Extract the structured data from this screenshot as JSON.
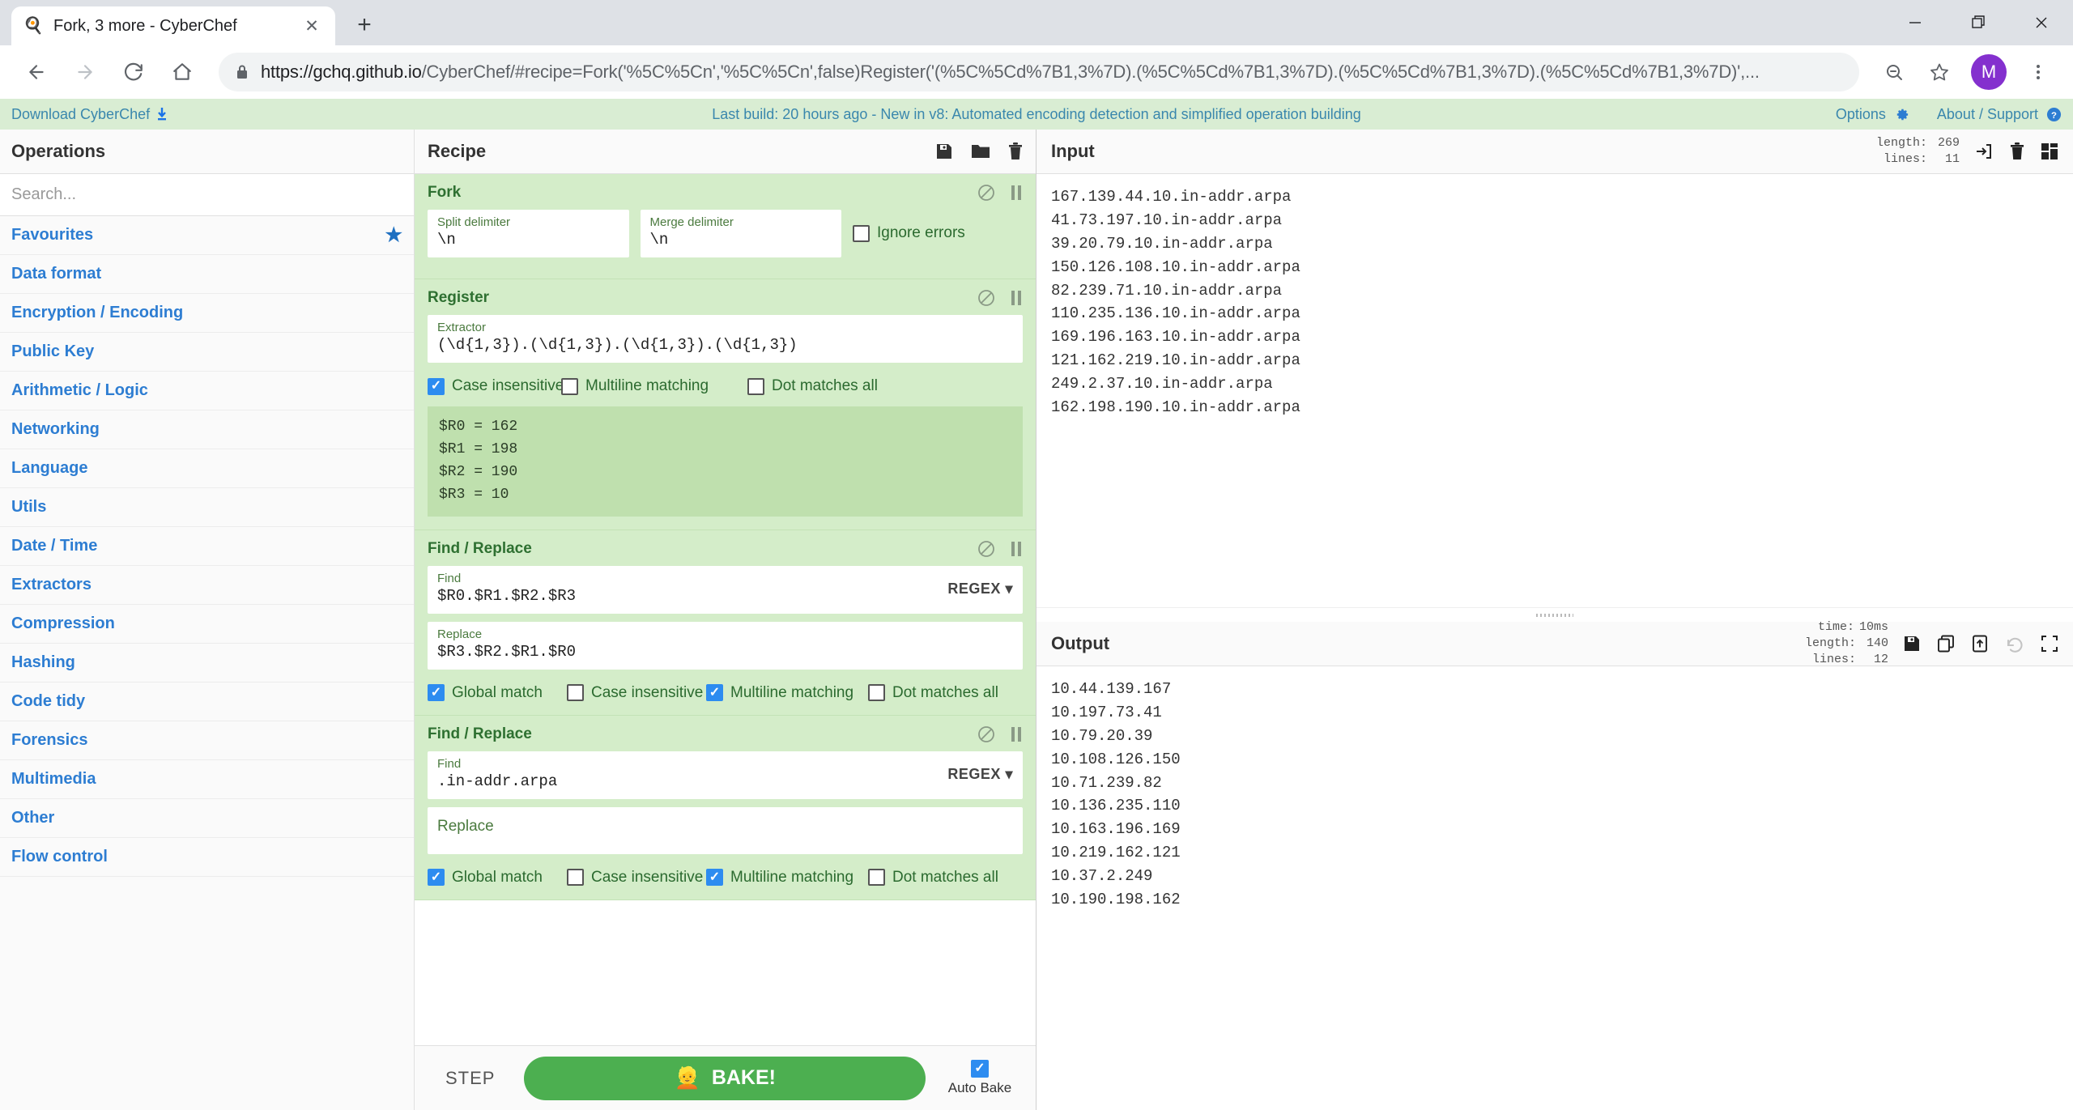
{
  "browser": {
    "tab": {
      "title": "Fork, 3 more - CyberChef",
      "favicon": "chef-hat-icon",
      "close_label": "✕"
    },
    "new_tab_label": "+",
    "window_controls": {
      "minimize": "minimize-icon",
      "maximize": "maximize-icon",
      "close": "close-icon"
    },
    "url_scheme": "https://",
    "url_host": "gchq.github.io",
    "url_path": "/CyberChef/#recipe=Fork('%5C%5Cn','%5C%5Cn',false)Register('(%5C%5Cd%7B1,3%7D).(%5C%5Cd%7B1,3%7D).(%5C%5Cd%7B1,3%7D).(%5C%5Cd%7B1,3%7D)',...",
    "avatar_initial": "M"
  },
  "banner": {
    "download_label": "Download CyberChef",
    "center_text": "Last build: 20 hours ago - New in v8: Automated encoding detection and simplified operation building",
    "options_label": "Options",
    "about_label": "About / Support"
  },
  "operations": {
    "title": "Operations",
    "search_placeholder": "Search...",
    "items": [
      {
        "label": "Favourites",
        "starred": true
      },
      {
        "label": "Data format",
        "starred": false
      },
      {
        "label": "Encryption / Encoding",
        "starred": false
      },
      {
        "label": "Public Key",
        "starred": false
      },
      {
        "label": "Arithmetic / Logic",
        "starred": false
      },
      {
        "label": "Networking",
        "starred": false
      },
      {
        "label": "Language",
        "starred": false
      },
      {
        "label": "Utils",
        "starred": false
      },
      {
        "label": "Date / Time",
        "starred": false
      },
      {
        "label": "Extractors",
        "starred": false
      },
      {
        "label": "Compression",
        "starred": false
      },
      {
        "label": "Hashing",
        "starred": false
      },
      {
        "label": "Code tidy",
        "starred": false
      },
      {
        "label": "Forensics",
        "starred": false
      },
      {
        "label": "Multimedia",
        "starred": false
      },
      {
        "label": "Other",
        "starred": false
      },
      {
        "label": "Flow control",
        "starred": false
      }
    ]
  },
  "recipe": {
    "title": "Recipe",
    "header_icons": [
      "save-icon",
      "folder-icon",
      "trash-icon"
    ],
    "ops": {
      "fork": {
        "name": "Fork",
        "split_label": "Split delimiter",
        "split_value": "\\n",
        "merge_label": "Merge delimiter",
        "merge_value": "\\n",
        "ignore_errors_label": "Ignore errors",
        "ignore_errors_checked": false
      },
      "register": {
        "name": "Register",
        "extractor_label": "Extractor",
        "extractor_value": "(\\d{1,3}).(\\d{1,3}).(\\d{1,3}).(\\d{1,3})",
        "checkboxes": [
          {
            "label": "Case insensitive",
            "checked": true
          },
          {
            "label": "Multiline matching",
            "checked": false
          },
          {
            "label": "Dot matches all",
            "checked": false
          }
        ],
        "registers_output": "$R0 = 162\n$R1 = 198\n$R2 = 190\n$R3 = 10"
      },
      "find_replace_1": {
        "name": "Find / Replace",
        "find_label": "Find",
        "find_value": "$R0.$R1.$R2.$R3",
        "find_mode": "REGEX",
        "replace_label": "Replace",
        "replace_value": "$R3.$R2.$R1.$R0",
        "checkboxes": [
          {
            "label": "Global match",
            "checked": true
          },
          {
            "label": "Case insensitive",
            "checked": false
          },
          {
            "label": "Multiline matching",
            "checked": true
          },
          {
            "label": "Dot matches all",
            "checked": false
          }
        ]
      },
      "find_replace_2": {
        "name": "Find / Replace",
        "find_label": "Find",
        "find_value": ".in-addr.arpa",
        "find_mode": "REGEX",
        "replace_label": "Replace",
        "replace_value": "",
        "replace_placeholder": "Replace",
        "checkboxes": [
          {
            "label": "Global match",
            "checked": true
          },
          {
            "label": "Case insensitive",
            "checked": false
          },
          {
            "label": "Multiline matching",
            "checked": true
          },
          {
            "label": "Dot matches all",
            "checked": false
          }
        ]
      }
    },
    "footer": {
      "step_label": "STEP",
      "bake_label": "BAKE!",
      "bake_icon": "chef-icon",
      "auto_bake_label": "Auto Bake",
      "auto_bake_checked": true
    }
  },
  "input": {
    "title": "Input",
    "meta": {
      "length_key": "length:",
      "length_value": "269",
      "lines_key": "lines:",
      "lines_value": "11"
    },
    "icons": [
      "open-file-icon",
      "clear-icon",
      "add-tab-icon"
    ],
    "content": "167.139.44.10.in-addr.arpa\n41.73.197.10.in-addr.arpa\n39.20.79.10.in-addr.arpa\n150.126.108.10.in-addr.arpa\n82.239.71.10.in-addr.arpa\n110.235.136.10.in-addr.arpa\n169.196.163.10.in-addr.arpa\n121.162.219.10.in-addr.arpa\n249.2.37.10.in-addr.arpa\n162.198.190.10.in-addr.arpa"
  },
  "output": {
    "title": "Output",
    "meta": {
      "time_key": "time:",
      "time_value": "10ms",
      "length_key": "length:",
      "length_value": "140",
      "lines_key": "lines:",
      "lines_value": "12"
    },
    "icons": [
      "save-icon",
      "copy-icon",
      "replace-input-icon",
      "undo-icon",
      "maximise-icon"
    ],
    "content": "10.44.139.167\n10.197.73.41\n10.79.20.39\n10.108.126.150\n10.71.239.82\n10.136.235.110\n10.163.196.169\n10.219.162.121\n10.37.2.249\n10.190.198.162"
  }
}
